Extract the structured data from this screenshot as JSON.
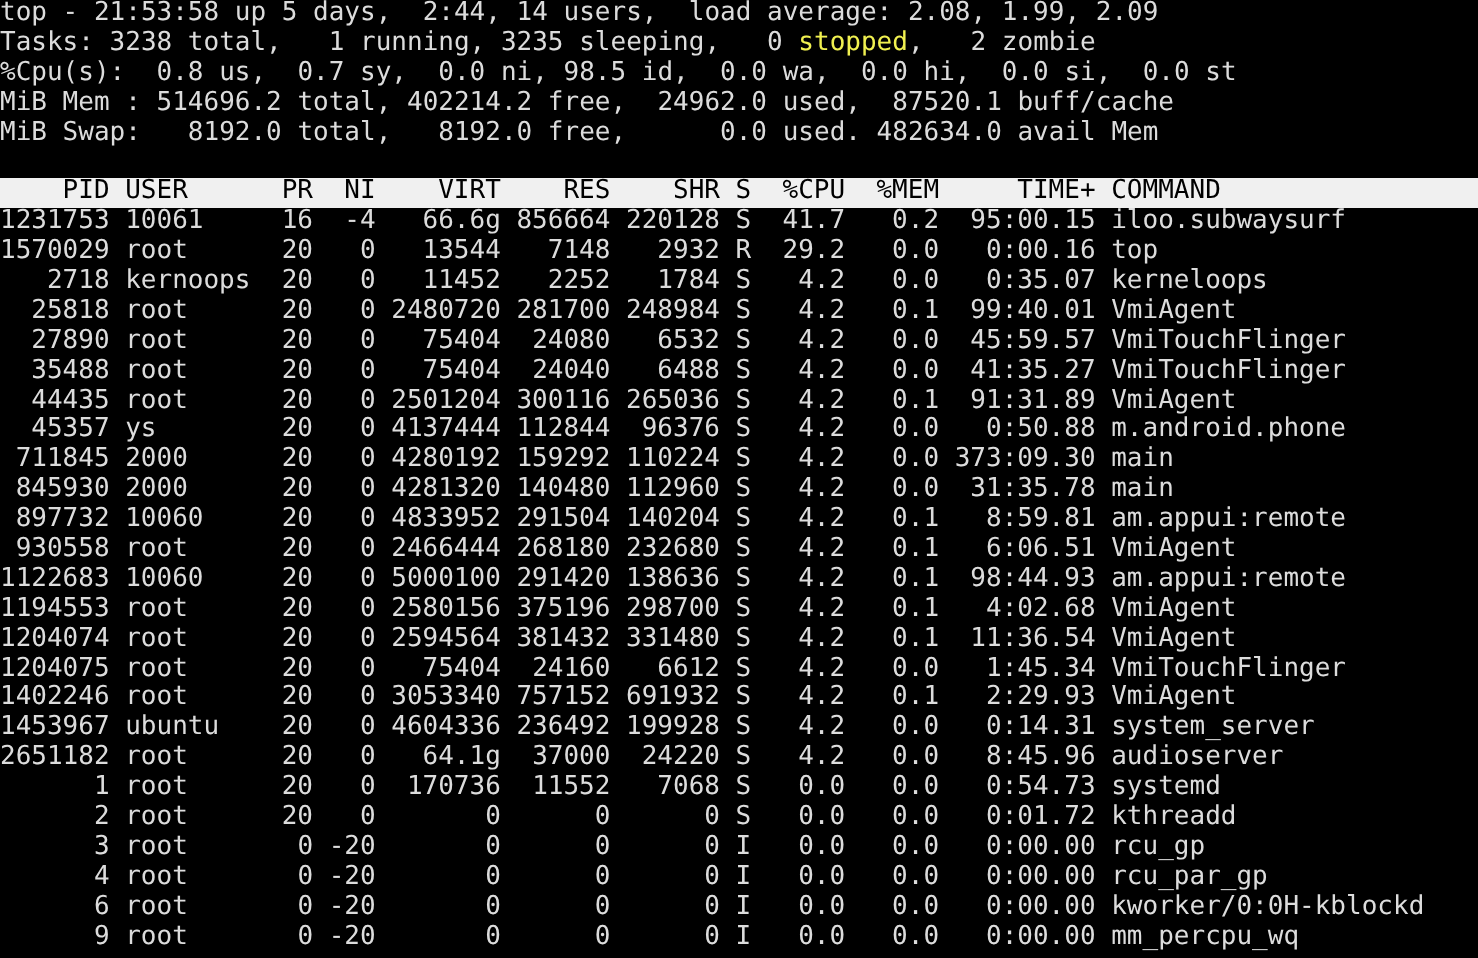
{
  "summary": [
    [
      {
        "text": "top - 21:53:58 up 5 days,  2:44, 14 users,  load average: 2.08, 1.99, 2.09",
        "highlight": false
      }
    ],
    [
      {
        "text": "Tasks: 3238 total,   1 running, 3235 sleeping,   0 ",
        "highlight": false
      },
      {
        "text": "stopped",
        "highlight": true
      },
      {
        "text": ",   2 zombie",
        "highlight": false
      }
    ],
    [
      {
        "text": "%Cpu(s):  0.8 us,  0.7 sy,  0.0 ni, 98.5 id,  0.0 wa,  0.0 hi,  0.0 si,  0.0 st",
        "highlight": false
      }
    ],
    [
      {
        "text": "MiB Mem : 514696.2 total, 402214.2 free,  24962.0 used,  87520.1 buff/cache",
        "highlight": false
      }
    ],
    [
      {
        "text": "MiB Swap:   8192.0 total,   8192.0 free,      0.0 used. 482634.0 avail Mem",
        "highlight": false
      }
    ]
  ],
  "table": {
    "columns": [
      "PID",
      "USER",
      "PR",
      "NI",
      "VIRT",
      "RES",
      "SHR",
      "S",
      "%CPU",
      "%MEM",
      "TIME+",
      "COMMAND"
    ],
    "rows": [
      [
        "1231753",
        "10061",
        "16",
        "-4",
        "66.6g",
        "856664",
        "220128",
        "S",
        "41.7",
        "0.2",
        "95:00.15",
        "iloo.subwaysurf"
      ],
      [
        "1570029",
        "root",
        "20",
        "0",
        "13544",
        "7148",
        "2932",
        "R",
        "29.2",
        "0.0",
        "0:00.16",
        "top"
      ],
      [
        "2718",
        "kernoops",
        "20",
        "0",
        "11452",
        "2252",
        "1784",
        "S",
        "4.2",
        "0.0",
        "0:35.07",
        "kerneloops"
      ],
      [
        "25818",
        "root",
        "20",
        "0",
        "2480720",
        "281700",
        "248984",
        "S",
        "4.2",
        "0.1",
        "99:40.01",
        "VmiAgent"
      ],
      [
        "27890",
        "root",
        "20",
        "0",
        "75404",
        "24080",
        "6532",
        "S",
        "4.2",
        "0.0",
        "45:59.57",
        "VmiTouchFlinger"
      ],
      [
        "35488",
        "root",
        "20",
        "0",
        "75404",
        "24040",
        "6488",
        "S",
        "4.2",
        "0.0",
        "41:35.27",
        "VmiTouchFlinger"
      ],
      [
        "44435",
        "root",
        "20",
        "0",
        "2501204",
        "300116",
        "265036",
        "S",
        "4.2",
        "0.1",
        "91:31.89",
        "VmiAgent"
      ],
      [
        "45357",
        "ys",
        "20",
        "0",
        "4137444",
        "112844",
        "96376",
        "S",
        "4.2",
        "0.0",
        "0:50.88",
        "m.android.phone"
      ],
      [
        "711845",
        "2000",
        "20",
        "0",
        "4280192",
        "159292",
        "110224",
        "S",
        "4.2",
        "0.0",
        "373:09.30",
        "main"
      ],
      [
        "845930",
        "2000",
        "20",
        "0",
        "4281320",
        "140480",
        "112960",
        "S",
        "4.2",
        "0.0",
        "31:35.78",
        "main"
      ],
      [
        "897732",
        "10060",
        "20",
        "0",
        "4833952",
        "291504",
        "140204",
        "S",
        "4.2",
        "0.1",
        "8:59.81",
        "am.appui:remote"
      ],
      [
        "930558",
        "root",
        "20",
        "0",
        "2466444",
        "268180",
        "232680",
        "S",
        "4.2",
        "0.1",
        "6:06.51",
        "VmiAgent"
      ],
      [
        "1122683",
        "10060",
        "20",
        "0",
        "5000100",
        "291420",
        "138636",
        "S",
        "4.2",
        "0.1",
        "98:44.93",
        "am.appui:remote"
      ],
      [
        "1194553",
        "root",
        "20",
        "0",
        "2580156",
        "375196",
        "298700",
        "S",
        "4.2",
        "0.1",
        "4:02.68",
        "VmiAgent"
      ],
      [
        "1204074",
        "root",
        "20",
        "0",
        "2594564",
        "381432",
        "331480",
        "S",
        "4.2",
        "0.1",
        "11:36.54",
        "VmiAgent"
      ],
      [
        "1204075",
        "root",
        "20",
        "0",
        "75404",
        "24160",
        "6612",
        "S",
        "4.2",
        "0.0",
        "1:45.34",
        "VmiTouchFlinger"
      ],
      [
        "1402246",
        "root",
        "20",
        "0",
        "3053340",
        "757152",
        "691932",
        "S",
        "4.2",
        "0.1",
        "2:29.93",
        "VmiAgent"
      ],
      [
        "1453967",
        "ubuntu",
        "20",
        "0",
        "4604336",
        "236492",
        "199928",
        "S",
        "4.2",
        "0.0",
        "0:14.31",
        "system_server"
      ],
      [
        "2651182",
        "root",
        "20",
        "0",
        "64.1g",
        "37000",
        "24220",
        "S",
        "4.2",
        "0.0",
        "8:45.96",
        "audioserver"
      ],
      [
        "1",
        "root",
        "20",
        "0",
        "170736",
        "11552",
        "7068",
        "S",
        "0.0",
        "0.0",
        "0:54.73",
        "systemd"
      ],
      [
        "2",
        "root",
        "20",
        "0",
        "0",
        "0",
        "0",
        "S",
        "0.0",
        "0.0",
        "0:01.72",
        "kthreadd"
      ],
      [
        "3",
        "root",
        "0",
        "-20",
        "0",
        "0",
        "0",
        "I",
        "0.0",
        "0.0",
        "0:00.00",
        "rcu_gp"
      ],
      [
        "4",
        "root",
        "0",
        "-20",
        "0",
        "0",
        "0",
        "I",
        "0.0",
        "0.0",
        "0:00.00",
        "rcu_par_gp"
      ],
      [
        "6",
        "root",
        "0",
        "-20",
        "0",
        "0",
        "0",
        "I",
        "0.0",
        "0.0",
        "0:00.00",
        "kworker/0:0H-kblockd"
      ],
      [
        "9",
        "root",
        "0",
        "-20",
        "0",
        "0",
        "0",
        "I",
        "0.0",
        "0.0",
        "0:00.00",
        "mm_percpu_wq"
      ]
    ]
  }
}
